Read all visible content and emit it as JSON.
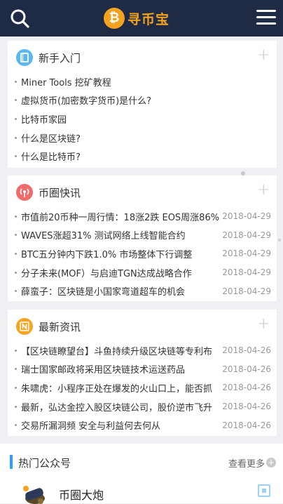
{
  "header": {
    "logo_text": "寻币宝",
    "logo_glyph": "₿"
  },
  "sections": [
    {
      "title": "新手入门",
      "icon": "book-icon",
      "items": [
        {
          "text": "Miner Tools 挖矿教程"
        },
        {
          "text": "虚拟货币(加密数字货币)是什么?"
        },
        {
          "text": "比特币家园"
        },
        {
          "text": "什么是区块链?"
        },
        {
          "text": "什么是比特币?"
        }
      ]
    },
    {
      "title": "币圈快讯",
      "icon": "broadcast-icon",
      "items": [
        {
          "text": "市值前20币种一周行情：18涨2跌 EOS周涨86%",
          "date": "2018-04-29"
        },
        {
          "text": "WAVES涨超31% 测试网络上线智能合约",
          "date": "2018-04-29"
        },
        {
          "text": "BTC五分钟内下跌1.0% 市场整体下行调整",
          "date": "2018-04-29"
        },
        {
          "text": "分子未来(MOF）与启迪TGN达成战略合作",
          "date": "2018-04-29"
        },
        {
          "text": "薛蛮子：区块链是小国家弯道超车的机会",
          "date": "2018-04-29"
        }
      ]
    },
    {
      "title": "最新资讯",
      "icon": "news-icon",
      "items": [
        {
          "text": "【区块链瞭望台】斗鱼持续升级区块链等专利布",
          "date": "2018-04-26"
        },
        {
          "text": "瑞士国家邮政将采用区块链技术运送药品",
          "date": "2018-04-26"
        },
        {
          "text": "朱啸虎：小程序正处在爆发的火山口上，能否抓",
          "date": "2018-04-26"
        },
        {
          "text": "最新，弘达金控入股区块链公司，股价逆市飞升",
          "date": "2018-04-26"
        },
        {
          "text": "交易所漏洞频 安全与利益何去何从",
          "date": "2018-04-26"
        }
      ]
    }
  ],
  "hot": {
    "title": "热门公众号",
    "more": "查看更多",
    "account_name": "币圈大炮"
  },
  "colors": {
    "header_bg": "#1f2a44",
    "accent": "#f3a31f",
    "section_bar": "#2e9ff0"
  }
}
